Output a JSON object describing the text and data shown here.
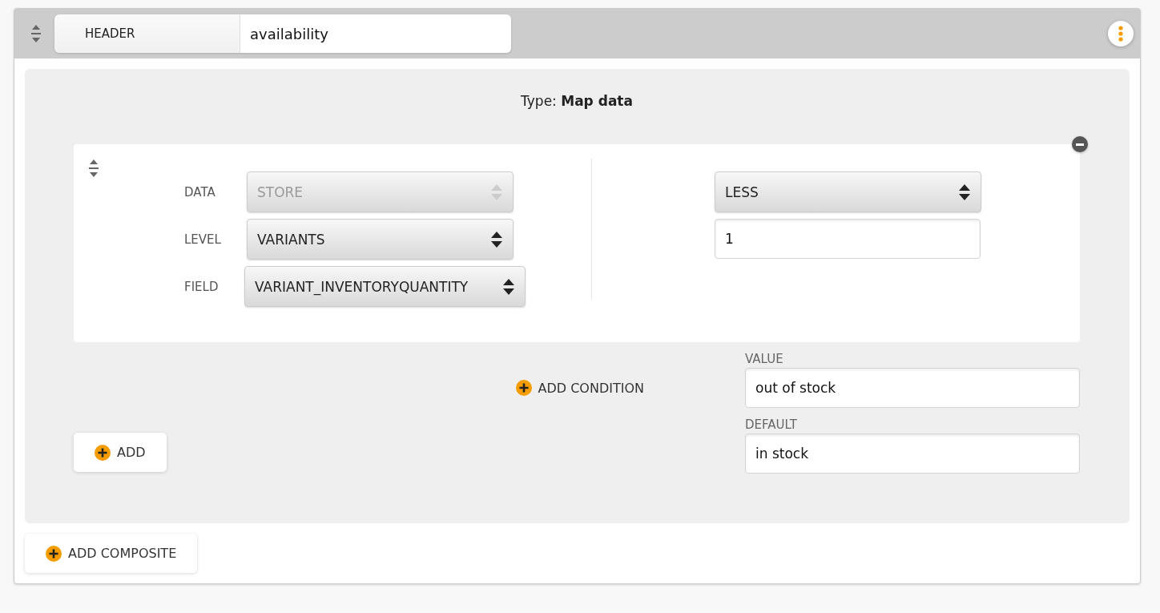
{
  "header": {
    "label": "HEADER",
    "value": "availability"
  },
  "type_line": "Type: **Map data**",
  "condition": {
    "fields": [
      {
        "label": "DATA",
        "value": "STORE",
        "disabled": true
      },
      {
        "label": "LEVEL",
        "value": "VARIANTS",
        "disabled": false
      },
      {
        "label": "FIELD",
        "value": "VARIANT_INVENTORYQUANTITY",
        "disabled": false
      }
    ],
    "operator": {
      "value": "LESS",
      "disabled": false
    },
    "operand": {
      "value": "1"
    }
  },
  "add_condition": "ADD CONDITION",
  "outputs": [
    {
      "label": "VALUE",
      "value": "out of stock"
    },
    {
      "label": "DEFAULT",
      "value": "in stock"
    }
  ],
  "add_button": "ADD",
  "add_composite": "ADD COMPOSITE"
}
